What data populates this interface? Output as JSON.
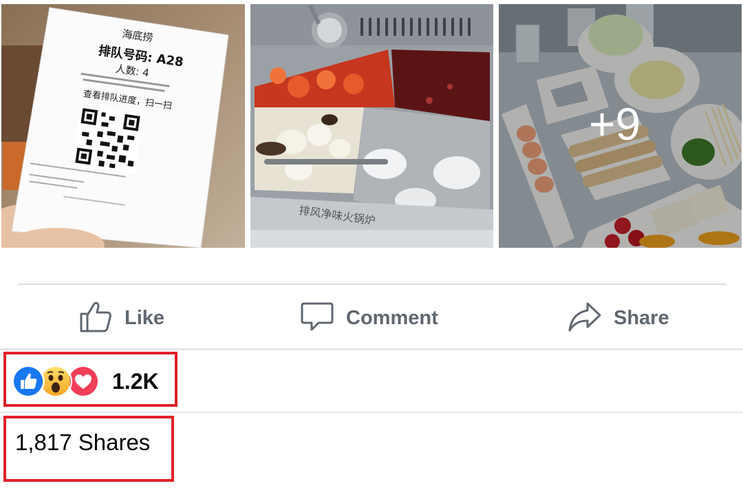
{
  "photos": {
    "receipt_lines": [
      "海底捞",
      "排队号码: A28",
      "人数: 4",
      "查看排队进度，扫一扫"
    ],
    "pot_text": "排风净味火锅炉",
    "more_count": "+9"
  },
  "actions": {
    "like_label": "Like",
    "comment_label": "Comment",
    "share_label": "Share"
  },
  "reactions": {
    "icons": [
      "like-reaction",
      "wow-reaction",
      "love-reaction"
    ],
    "count": "1.2K"
  },
  "shares": {
    "label": "1,817 Shares"
  },
  "colors": {
    "action_gray": "#606770",
    "highlight_red": "#e0202a",
    "like_blue": "#1877f2",
    "love_red": "#f33e58",
    "wow_yellow": "#f7b125"
  }
}
